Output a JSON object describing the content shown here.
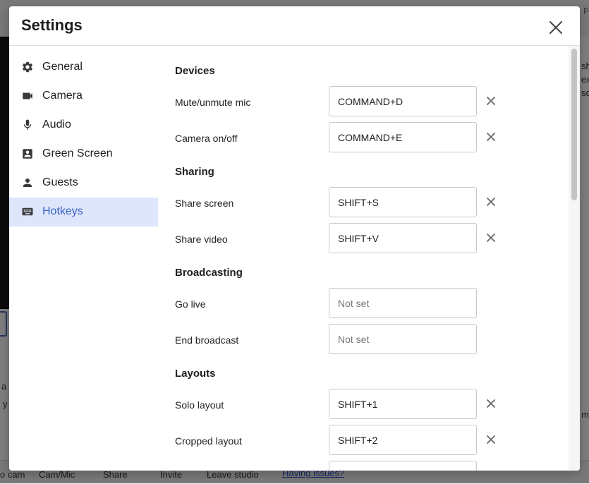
{
  "background": {
    "left_footer_text": "o cam",
    "footer_items": [
      "Cam/Mic",
      "Share",
      "Invite",
      "Leave studio"
    ],
    "issues_link": "Having issues?",
    "left_fragment_1": "a",
    "left_fragment_2": "y",
    "right_fragment_top": "Fi",
    "right_fragment_1": "sh",
    "right_fragment_2": "ex",
    "right_fragment_3": "so",
    "right_fragment_4": "m"
  },
  "modal": {
    "title": "Settings",
    "close_icon": "close-icon"
  },
  "sidebar": {
    "items": [
      {
        "label": "General",
        "icon": "gear-icon",
        "active": false
      },
      {
        "label": "Camera",
        "icon": "video-camera-icon",
        "active": false
      },
      {
        "label": "Audio",
        "icon": "microphone-icon",
        "active": false
      },
      {
        "label": "Green Screen",
        "icon": "person-badge-icon",
        "active": false
      },
      {
        "label": "Guests",
        "icon": "person-icon",
        "active": false
      },
      {
        "label": "Hotkeys",
        "icon": "keyboard-icon",
        "active": true
      }
    ],
    "active_color": "#3c64c8",
    "active_background": "#dde6fb"
  },
  "hotkeys": {
    "sections": [
      {
        "title": "Devices",
        "rows": [
          {
            "label": "Mute/unmute mic",
            "value": "COMMAND+D",
            "placeholder": "Not set"
          },
          {
            "label": "Camera on/off",
            "value": "COMMAND+E",
            "placeholder": "Not set"
          }
        ]
      },
      {
        "title": "Sharing",
        "rows": [
          {
            "label": "Share screen",
            "value": "SHIFT+S",
            "placeholder": "Not set"
          },
          {
            "label": "Share video",
            "value": "SHIFT+V",
            "placeholder": "Not set"
          }
        ]
      },
      {
        "title": "Broadcasting",
        "rows": [
          {
            "label": "Go live",
            "value": "",
            "placeholder": "Not set"
          },
          {
            "label": "End broadcast",
            "value": "",
            "placeholder": "Not set"
          }
        ]
      },
      {
        "title": "Layouts",
        "rows": [
          {
            "label": "Solo layout",
            "value": "SHIFT+1",
            "placeholder": "Not set"
          },
          {
            "label": "Cropped layout",
            "value": "SHIFT+2",
            "placeholder": "Not set"
          }
        ]
      }
    ]
  }
}
